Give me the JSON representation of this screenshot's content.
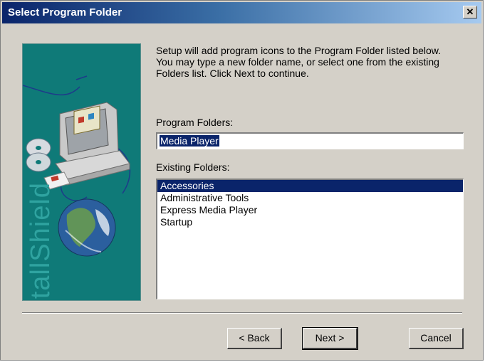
{
  "window": {
    "title": "Select Program Folder",
    "close_label": "✕"
  },
  "side_panel": {
    "brand": "InstallShield"
  },
  "description": "Setup will add program icons to the Program Folder listed below.\nYou may type a new folder name, or select one from the existing\nFolders list.  Click Next to continue.",
  "program_folders": {
    "label": "Program Folders:",
    "value": "Media Player"
  },
  "existing_folders": {
    "label": "Existing Folders:",
    "items": [
      {
        "label": "Accessories",
        "selected": true
      },
      {
        "label": "Administrative Tools",
        "selected": false
      },
      {
        "label": "Express Media Player",
        "selected": false
      },
      {
        "label": "Startup",
        "selected": false
      }
    ]
  },
  "buttons": {
    "back": "< Back",
    "next": "Next >",
    "cancel": "Cancel"
  },
  "colors": {
    "titlebar": "#0a246a",
    "panel": "#0f7a78",
    "selection": "#0a246a"
  },
  "icons": [
    "close-icon",
    "computer-icon",
    "cd-icon",
    "globe-icon"
  ]
}
